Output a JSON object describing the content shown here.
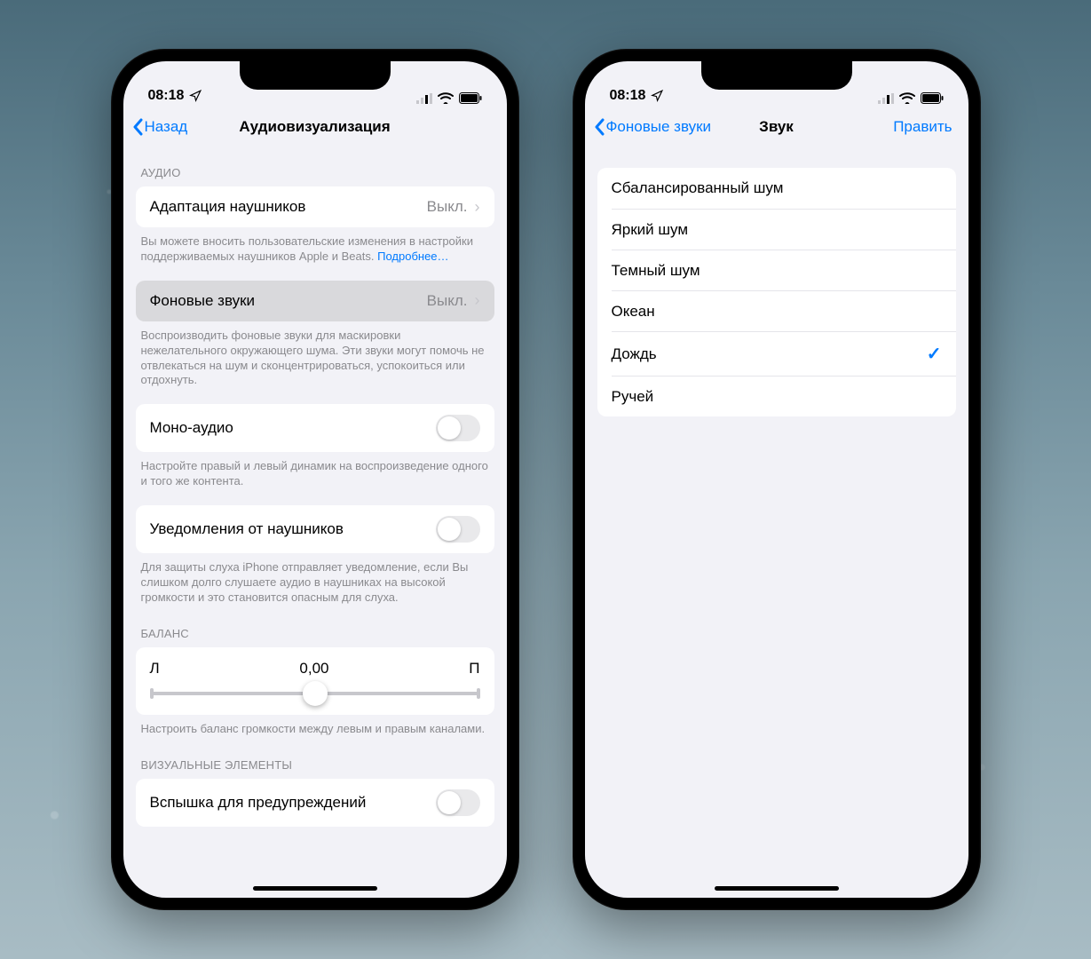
{
  "status": {
    "time": "08:18"
  },
  "phoneA": {
    "nav": {
      "back": "Назад",
      "title": "Аудиовизуализация"
    },
    "section_audio_header": "АУДИО",
    "row_headphone_adapt": {
      "label": "Адаптация наушников",
      "value": "Выкл."
    },
    "footer_headphone_adapt": "Вы можете вносить пользовательские изменения в настройки поддерживаемых наушников Apple и Beats. ",
    "footer_headphone_adapt_link": "Подробнее…",
    "row_bg_sounds": {
      "label": "Фоновые звуки",
      "value": "Выкл."
    },
    "footer_bg_sounds": "Воспроизводить фоновые звуки для маскировки нежелательного окружающего шума. Эти звуки могут помочь не отвлекаться на шум и сконцентрироваться, успокоиться или отдохнуть.",
    "row_mono": {
      "label": "Моно-аудио"
    },
    "footer_mono": "Настройте правый и левый динамик на воспроизведение одного и того же контента.",
    "row_notif": {
      "label": "Уведомления от наушников"
    },
    "footer_notif": "Для защиты слуха iPhone отправляет уведомление, если Вы слишком долго слушаете аудио в наушниках на высокой громкости и это становится опасным для слуха.",
    "balance_header": "БАЛАНС",
    "balance": {
      "left": "Л",
      "value": "0,00",
      "right": "П"
    },
    "footer_balance": "Настроить баланс громкости между левым и правым каналами.",
    "section_visual_header": "ВИЗУАЛЬНЫЕ ЭЛЕМЕНТЫ",
    "row_flash": {
      "label": "Вспышка для предупреждений"
    }
  },
  "phoneB": {
    "nav": {
      "back": "Фоновые звуки",
      "title": "Звук",
      "right": "Править"
    },
    "sounds": [
      {
        "label": "Сбалансированный шум",
        "selected": false
      },
      {
        "label": "Яркий шум",
        "selected": false
      },
      {
        "label": "Темный шум",
        "selected": false
      },
      {
        "label": "Океан",
        "selected": false
      },
      {
        "label": "Дождь",
        "selected": true
      },
      {
        "label": "Ручей",
        "selected": false
      }
    ]
  }
}
